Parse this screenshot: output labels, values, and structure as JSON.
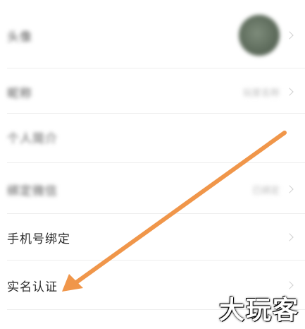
{
  "rows": [
    {
      "label": "头像",
      "value": "",
      "blurred": true
    },
    {
      "label": "昵称",
      "value": "玩家名称",
      "blurred": true
    },
    {
      "label": "个人简介",
      "value": "",
      "blurred": true
    },
    {
      "label": "绑定微信",
      "value": "已绑定",
      "blurred": true
    },
    {
      "label": "手机号绑定",
      "value": "",
      "blurred": false
    },
    {
      "label": "实名认证",
      "value": "",
      "blurred": false
    }
  ],
  "annotation": {
    "arrow_color": "#f0964a"
  },
  "watermark": {
    "text": "大玩客"
  }
}
